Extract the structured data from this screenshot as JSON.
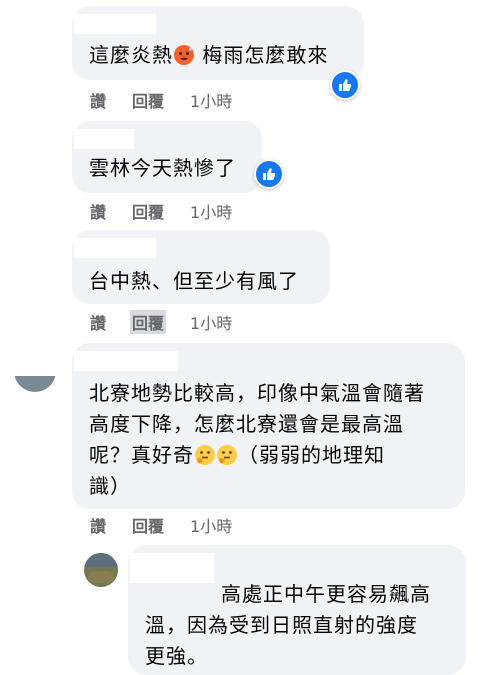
{
  "comments": [
    {
      "text_a": "這麼炎熱",
      "text_b": " 梅雨怎麼敢來",
      "emoji": "hot-face-icon",
      "reactions": "like-icon",
      "actions": {
        "like": "讚",
        "reply": "回覆",
        "time": "1小時"
      }
    },
    {
      "text": "雲林今天熱慘了",
      "reactions": "like-icon",
      "actions": {
        "like": "讚",
        "reply": "回覆",
        "time": "1小時"
      }
    },
    {
      "text": "台中熱、但至少有風了",
      "actions": {
        "like": "讚",
        "reply": "回覆",
        "time": "1小時"
      }
    },
    {
      "line1": "北寮地勢比較高，印像中氣溫會隨著",
      "line2": "高度下降，怎麼北寮還會是最高溫",
      "line3_a": "呢？真好奇",
      "line3_b": "（弱弱的地理知",
      "line4": "識）",
      "emoji": "thinking-face-icon",
      "actions": {
        "like": "讚",
        "reply": "回覆",
        "time": "1小時"
      }
    },
    {
      "line1": "高處正中午更容易飆高",
      "line2": "溫，因為受到日照直射的強度",
      "line3": "更強。"
    }
  ],
  "colors": {
    "bubble": "#f0f2f5",
    "meta": "#65676b",
    "like_blue": "#1877f2"
  }
}
